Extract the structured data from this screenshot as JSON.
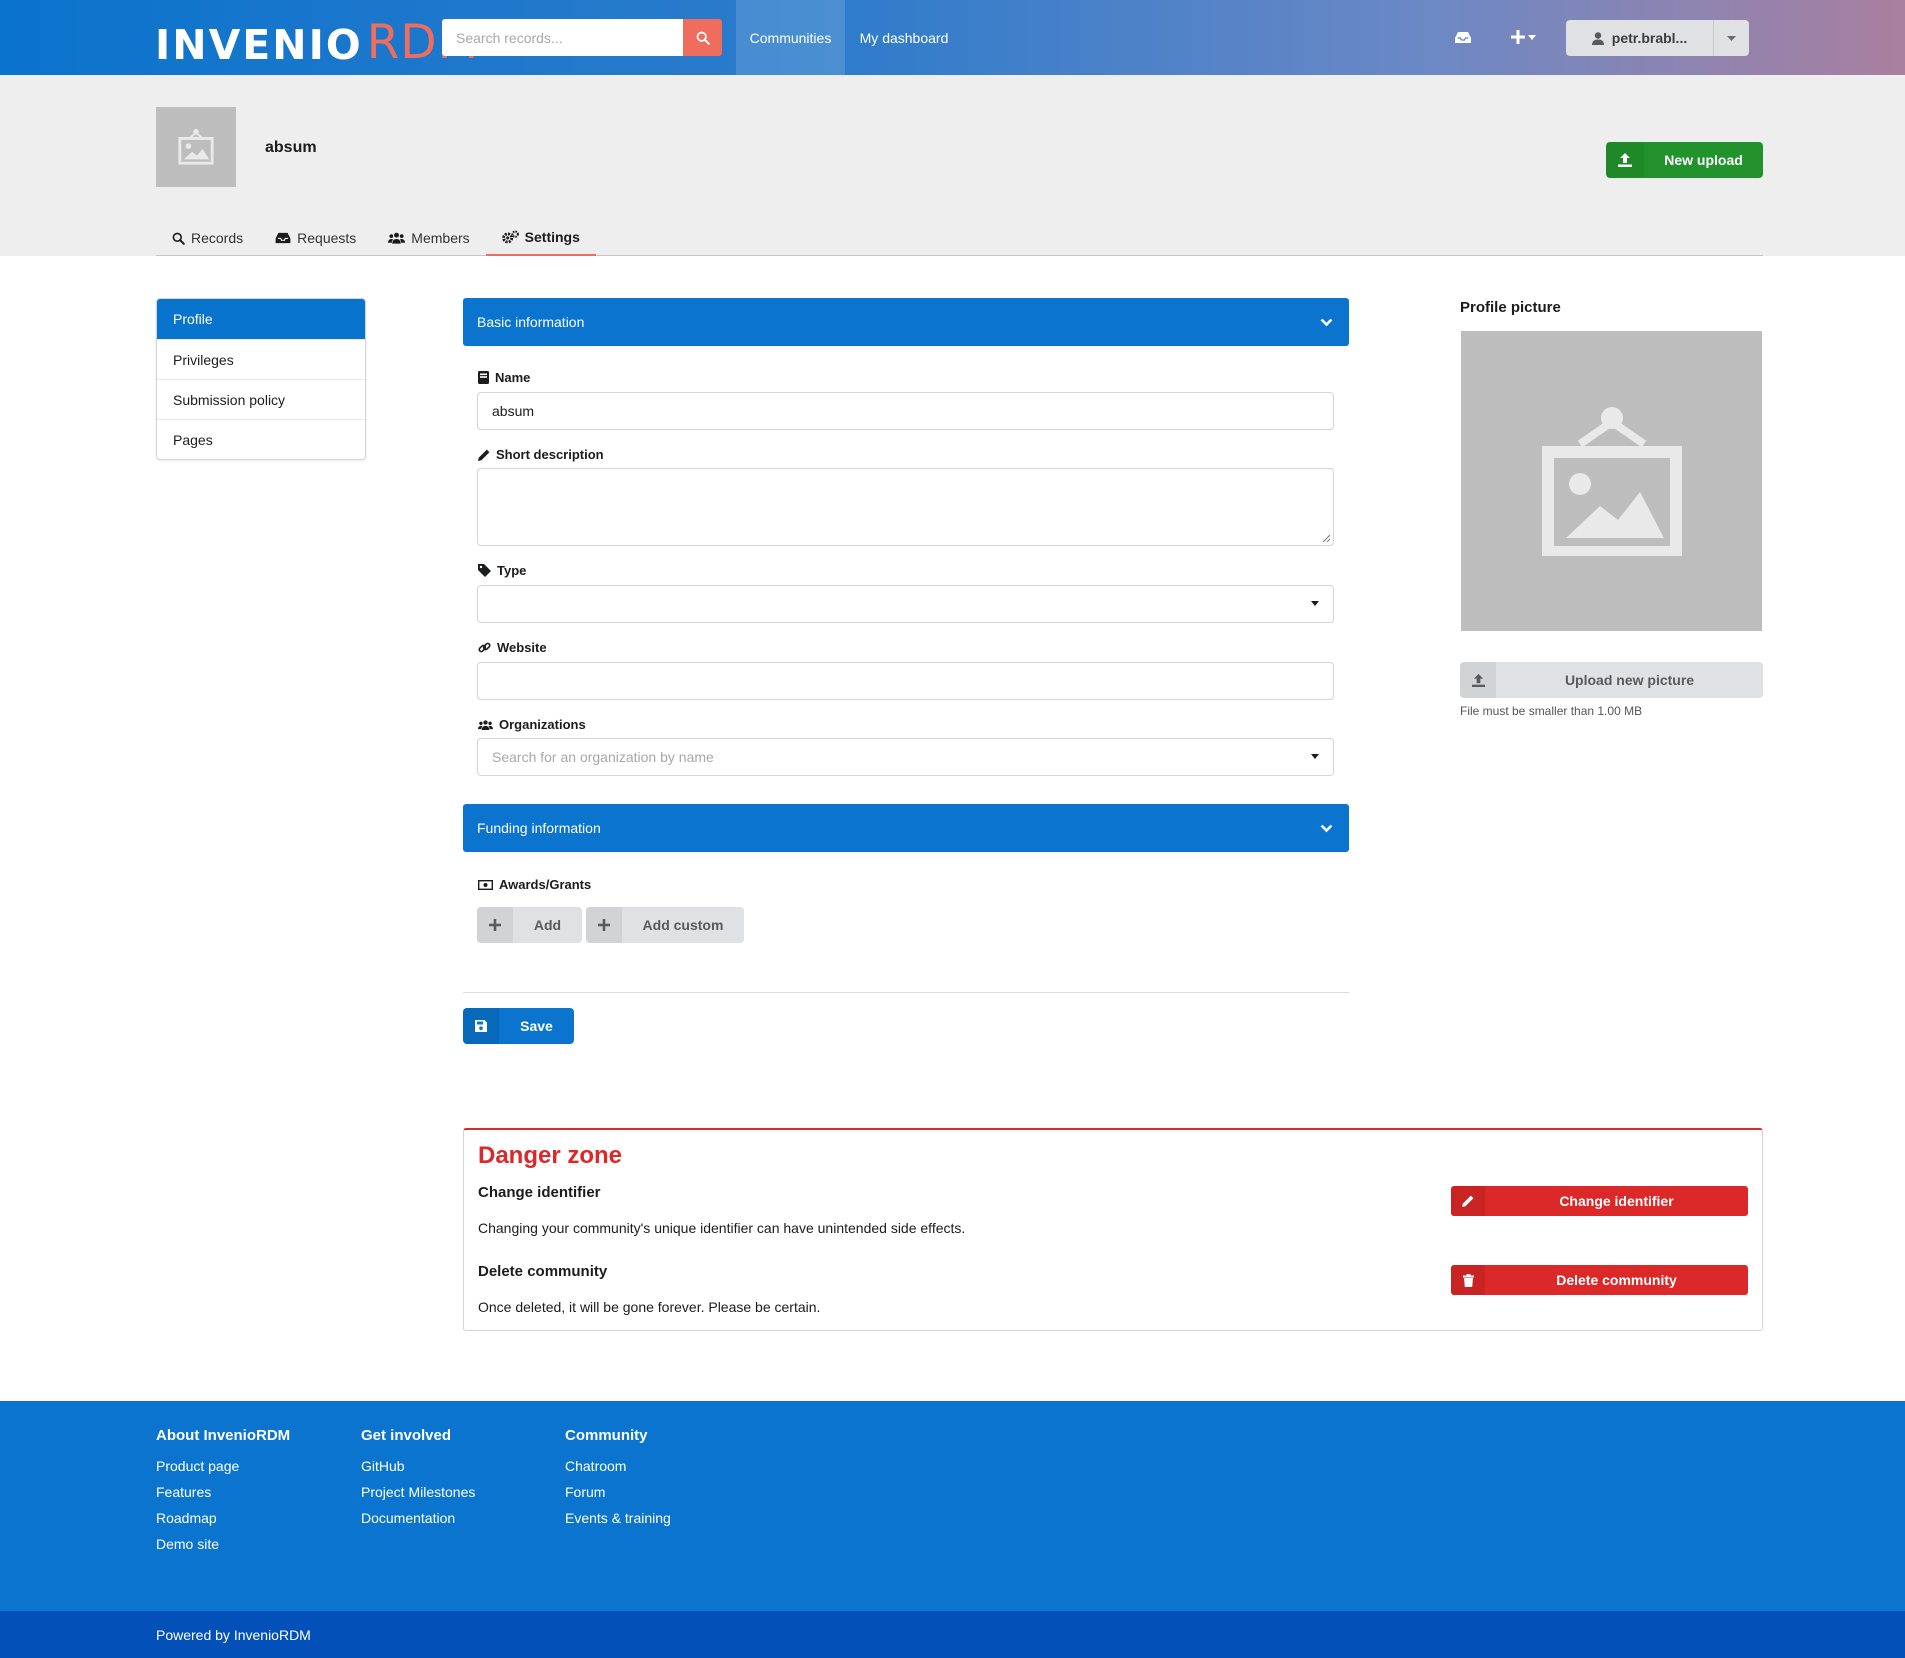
{
  "header": {
    "logo_word": "INVENIO",
    "logo_accent": "RDM",
    "search_placeholder": "Search records...",
    "nav": [
      "Communities",
      "My dashboard"
    ],
    "user_label": "petr.brabl..."
  },
  "community": {
    "title": "absum",
    "new_upload_label": "New upload",
    "tabs": [
      "Records",
      "Requests",
      "Members",
      "Settings"
    ],
    "active_tab": "Settings"
  },
  "side_menu": {
    "items": [
      "Profile",
      "Privileges",
      "Submission policy",
      "Pages"
    ],
    "active": "Profile"
  },
  "form": {
    "basic_info_title": "Basic information",
    "name_label": "Name",
    "name_value": "absum",
    "short_description_label": "Short description",
    "short_description_value": "",
    "type_label": "Type",
    "type_value": "",
    "website_label": "Website",
    "website_value": "",
    "organizations_label": "Organizations",
    "organizations_placeholder": "Search for an organization by name",
    "funding_title": "Funding information",
    "awards_label": "Awards/Grants",
    "add_label": "Add",
    "add_custom_label": "Add custom",
    "save_label": "Save"
  },
  "profile_picture": {
    "title": "Profile picture",
    "upload_label": "Upload new picture",
    "hint": "File must be smaller than 1.00 MB"
  },
  "danger_zone": {
    "title": "Danger zone",
    "change_identifier_heading": "Change identifier",
    "change_identifier_text": "Changing your community's unique identifier can have unintended side effects.",
    "change_identifier_button": "Change identifier",
    "delete_heading": "Delete community",
    "delete_text": "Once deleted, it will be gone forever. Please be certain.",
    "delete_button": "Delete community",
    "accent_color": "#db2828"
  },
  "footer": {
    "columns": [
      {
        "title": "About InvenioRDM",
        "links": [
          "Product page",
          "Features",
          "Roadmap",
          "Demo site"
        ]
      },
      {
        "title": "Get involved",
        "links": [
          "GitHub",
          "Project Milestones",
          "Documentation"
        ]
      },
      {
        "title": "Community",
        "links": [
          "Chatroom",
          "Forum",
          "Events & training"
        ]
      }
    ],
    "powered_by": "Powered by InvenioRDM"
  },
  "colors": {
    "primary": "#0a74cf",
    "brand_accent": "#ef6d5d",
    "success": "#21922c",
    "danger": "#db2828"
  }
}
